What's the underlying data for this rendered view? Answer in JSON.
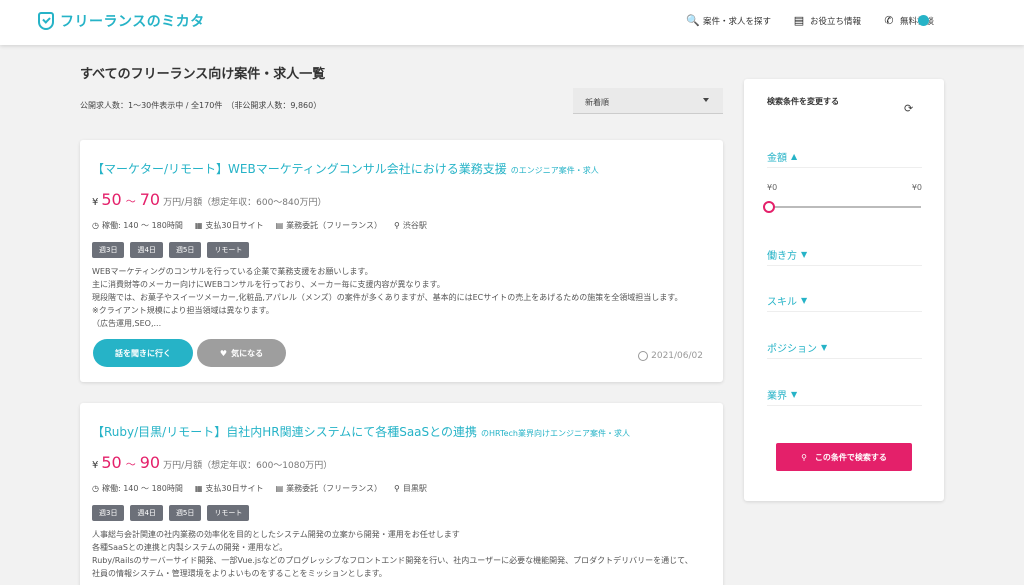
{
  "header": {
    "logo_text": "フリーランスのミカタ",
    "nav": [
      {
        "label": "案件・求人を探す",
        "icon": "search-icon",
        "glyph": "🔍"
      },
      {
        "label": "お役立ち情報",
        "icon": "document-icon",
        "glyph": "▤"
      },
      {
        "label": "無料相談",
        "icon": "phone-icon",
        "glyph": "✆"
      }
    ]
  },
  "page": {
    "title": "すべてのフリーランス向け案件・求人一覧",
    "count_line": "公開求人数：1～30件表示中 / 全170件　（非公開求人数：9,860）",
    "sort_value": "新着順"
  },
  "jobs": [
    {
      "title": "【マーケター/リモート】WEBマーケティングコンサル会社における業務支援",
      "subtitle": "のエンジニア案件・求人",
      "salary_min": "50",
      "salary_max": "70",
      "salary_unit": "万円/月額（想定年収：600～840万円）",
      "meta": [
        "稼働: 140 ～ 180時間",
        "支払30日サイト",
        "業務委託（フリーランス）",
        "渋谷駅"
      ],
      "tags": [
        "週3日",
        "週4日",
        "週5日",
        "リモート"
      ],
      "desc": [
        "WEBマーケティングのコンサルを行っている企業で業務支援をお願いします。",
        "主に消費財等のメーカー向けにWEBコンサルを行っており、メーカー毎に支援内容が異なります。",
        "現段階では、お菓子やスイーツメーカー,化粧品,アパレル（メンズ）の案件が多くありますが、基本的にはECサイトの売上をあげるための施策を全領域担当します。",
        "※クライアント規模により担当領域は異なります。",
        "（広告運用,SEO,..."
      ],
      "btn_primary": "話を聞きに行く",
      "btn_secondary": "気になる",
      "date": "2021/06/02"
    },
    {
      "title": "【Ruby/目黒/リモート】自社内HR関連システムにて各種SaaSとの連携",
      "subtitle": "のHRTech業界向けエンジニア案件・求人",
      "salary_min": "50",
      "salary_max": "90",
      "salary_unit": "万円/月額（想定年収：600～1080万円）",
      "meta": [
        "稼働: 140 ～ 180時間",
        "支払30日サイト",
        "業務委託（フリーランス）",
        "目黒駅"
      ],
      "tags": [
        "週3日",
        "週4日",
        "週5日",
        "リモート"
      ],
      "desc": [
        "人事総与会計関連の社内業務の効率化を目的としたシステム開発の立案から開発・運用をお任せします",
        "各種SaaSとの連携と内製システムの開発・運用など。",
        "Ruby/Railsのサーバーサイド開発、一部Vue.jsなどのプログレッシブなフロントエンド開発を行い、社内ユーザーに必要な機能開発、プロダクトデリバリーを通じて、",
        "社員の情報システム・管理環境をよりよいものをすることをミッションとします。"
      ]
    }
  ],
  "sidebar": {
    "title": "検索条件を変更する",
    "sections": [
      "金額",
      "働き方",
      "スキル",
      "ポジション",
      "業界"
    ],
    "range_min": "¥0",
    "range_max": "¥0",
    "search_button": "この条件で検索する"
  },
  "colors": {
    "accent": "#26b3c7",
    "pink": "#e4206a"
  }
}
